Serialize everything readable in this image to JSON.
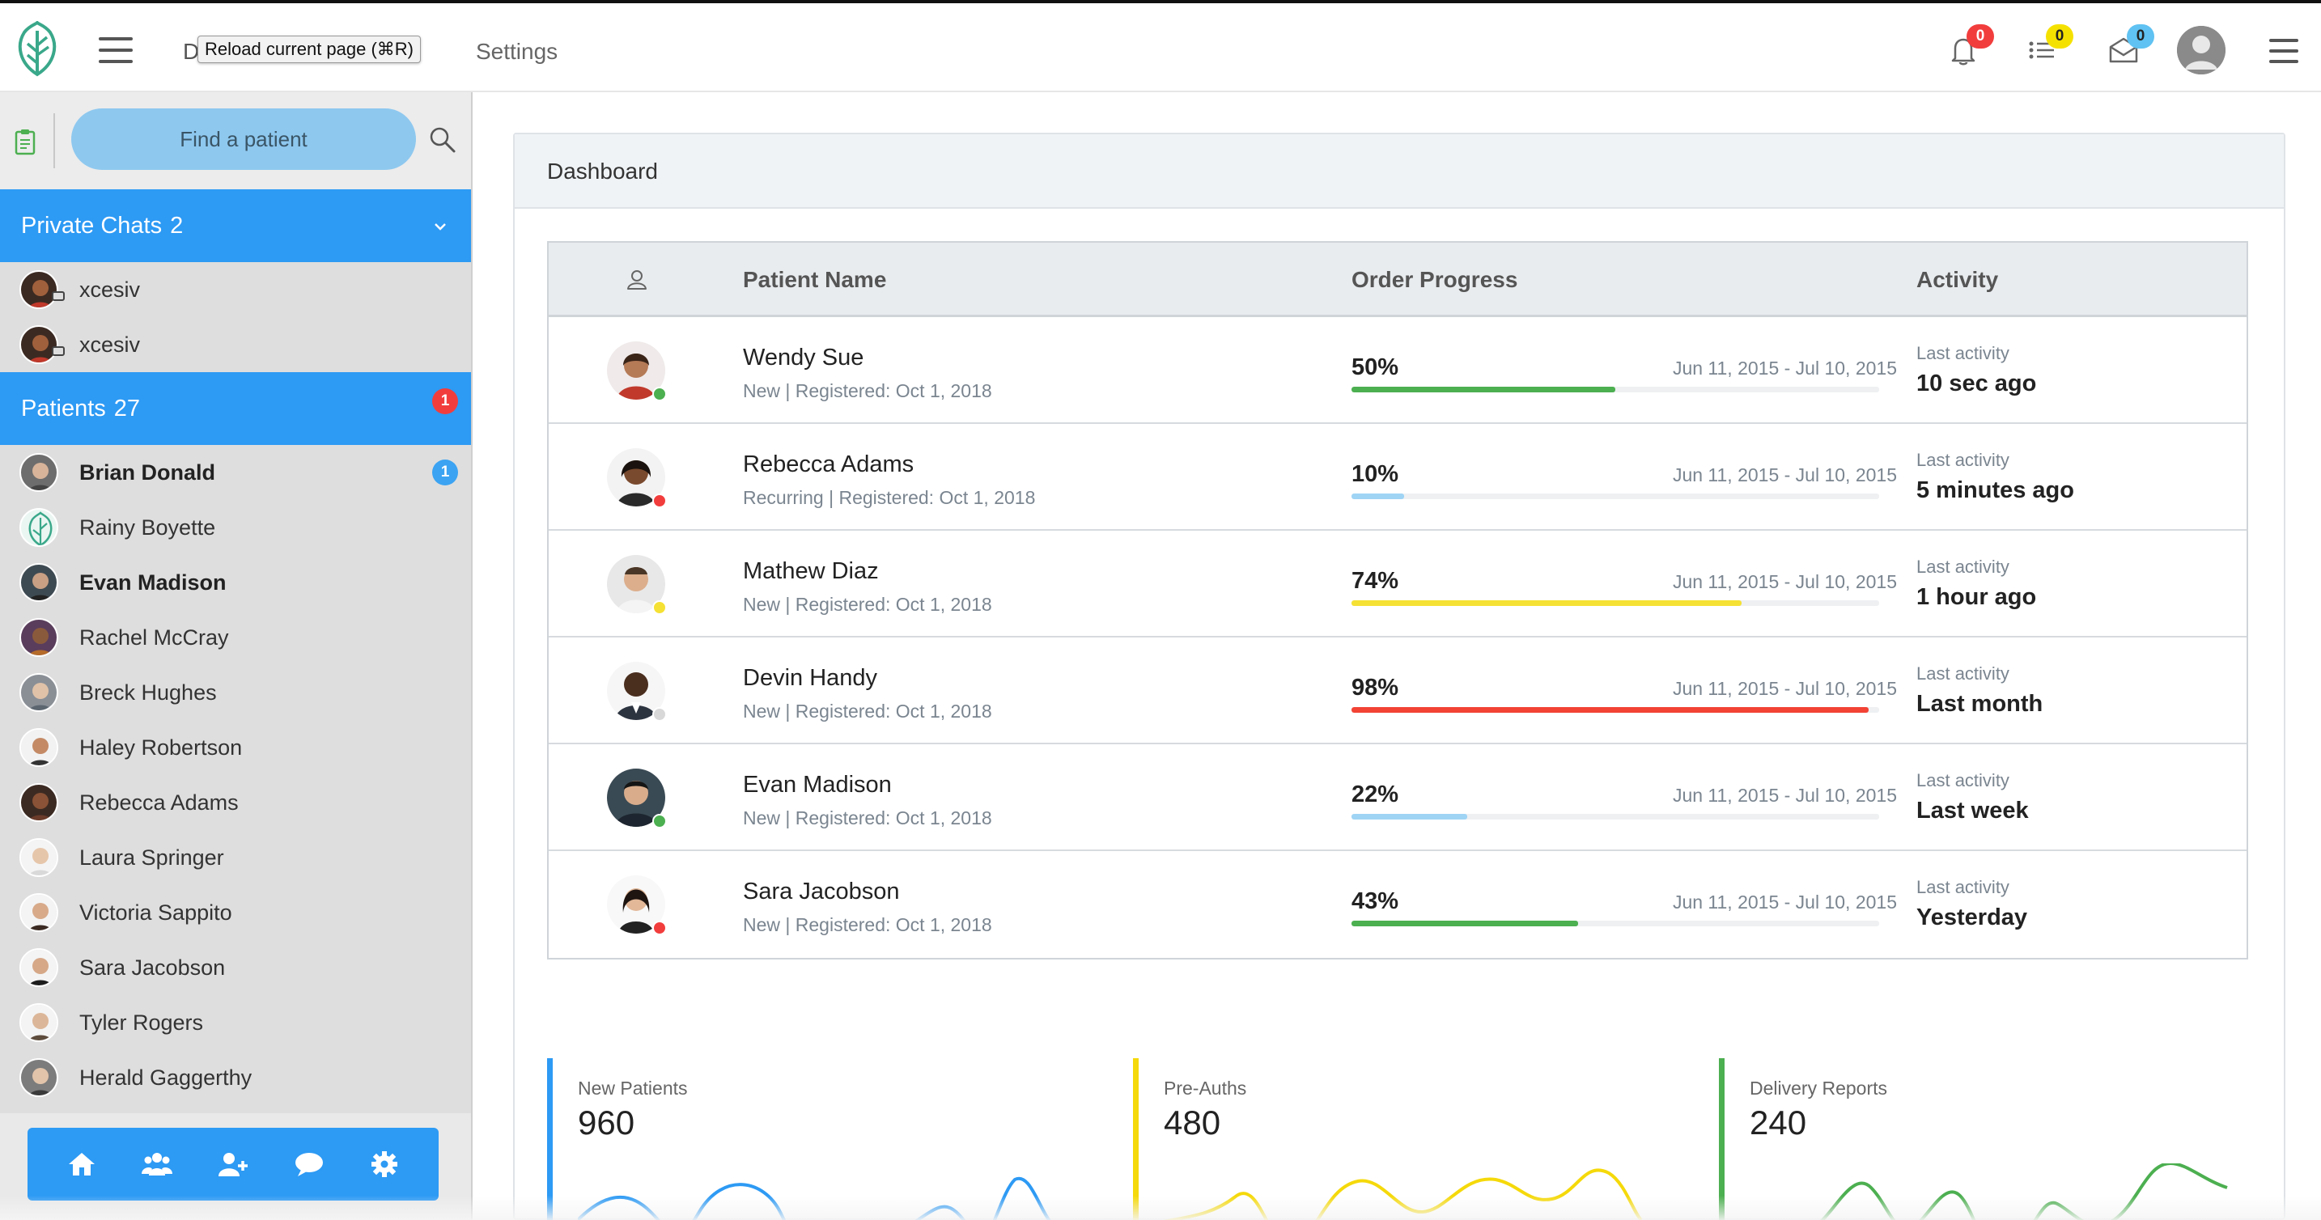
{
  "topbar": {
    "nav_dashboard_initial": "D",
    "tooltip": "Reload current page (⌘R)",
    "nav_settings": "Settings",
    "notifications_count": "0",
    "tasks_count": "0",
    "messages_count": "0"
  },
  "sidebar": {
    "search_button": "Find a patient",
    "private_chats": {
      "label": "Private Chats",
      "count": "2"
    },
    "chats": [
      {
        "name": "xcesiv"
      },
      {
        "name": "xcesiv"
      }
    ],
    "patients_section": {
      "label": "Patients",
      "count": "27",
      "badge": "1"
    },
    "patients": [
      {
        "name": "Brian Donald",
        "bold": true,
        "count": "1"
      },
      {
        "name": "Rainy Boyette"
      },
      {
        "name": "Evan Madison",
        "bold": true
      },
      {
        "name": "Rachel McCray"
      },
      {
        "name": "Breck Hughes"
      },
      {
        "name": "Haley Robertson"
      },
      {
        "name": "Rebecca Adams"
      },
      {
        "name": "Laura Springer"
      },
      {
        "name": "Victoria Sappito"
      },
      {
        "name": "Sara Jacobson"
      },
      {
        "name": "Tyler Rogers"
      },
      {
        "name": "Herald Gaggerthy"
      }
    ],
    "footer_icons": [
      "home-icon",
      "group-icon",
      "add-user-icon",
      "chat-icon",
      "settings-icon"
    ]
  },
  "main": {
    "card_title": "Dashboard",
    "table": {
      "headers": {
        "patient_name": "Patient Name",
        "order_progress": "Order Progress",
        "activity": "Activity"
      },
      "rows": [
        {
          "name": "Wendy Sue",
          "sub": "New | Registered: Oct 1, 2018",
          "progress": 50,
          "pct": "50%",
          "range": "Jun 11, 2015 - Jul 10, 2015",
          "activity_label": "Last activity",
          "activity": "10 sec ago",
          "bar_color": "#4caf50",
          "status_color": "#4caf50"
        },
        {
          "name": "Rebecca Adams",
          "sub": "Recurring | Registered: Oct 1, 2018",
          "progress": 10,
          "pct": "10%",
          "range": "Jun 11, 2015 - Jul 10, 2015",
          "activity_label": "Last activity",
          "activity": "5 minutes ago",
          "bar_color": "#9fd4f5",
          "status_color": "#f23d3d"
        },
        {
          "name": "Mathew Diaz",
          "sub": "New | Registered: Oct 1, 2018",
          "progress": 74,
          "pct": "74%",
          "range": "Jun 11, 2015 - Jul 10, 2015",
          "activity_label": "Last activity",
          "activity": "1 hour ago",
          "bar_color": "#f5e134",
          "status_color": "#f5e134"
        },
        {
          "name": "Devin Handy",
          "sub": "New | Registered: Oct 1, 2018",
          "progress": 98,
          "pct": "98%",
          "range": "Jun 11, 2015 - Jul 10, 2015",
          "activity_label": "Last activity",
          "activity": "Last month",
          "bar_color": "#f24335",
          "status_color": "#d8d8d8"
        },
        {
          "name": "Evan Madison",
          "sub": "New | Registered: Oct 1, 2018",
          "progress": 22,
          "pct": "22%",
          "range": "Jun 11, 2015 - Jul 10, 2015",
          "activity_label": "Last activity",
          "activity": "Last week",
          "bar_color": "#9fd4f5",
          "status_color": "#4caf50"
        },
        {
          "name": "Sara Jacobson",
          "sub": "New | Registered: Oct 1, 2018",
          "progress": 43,
          "pct": "43%",
          "range": "Jun 11, 2015 - Jul 10, 2015",
          "activity_label": "Last activity",
          "activity": "Yesterday",
          "bar_color": "#4caf50",
          "status_color": "#f23d3d"
        }
      ]
    },
    "stats": [
      {
        "label": "New Patients",
        "value": "960",
        "color": "#2d9af4"
      },
      {
        "label": "Pre-Auths",
        "value": "480",
        "color": "#f5d90a"
      },
      {
        "label": "Delivery Reports",
        "value": "240",
        "color": "#4caf50"
      }
    ]
  },
  "colors": {
    "accent": "#2d9af4",
    "badge_red": "#f23d3d",
    "badge_yellow": "#f5e100",
    "badge_blue": "#5fc2f2"
  }
}
